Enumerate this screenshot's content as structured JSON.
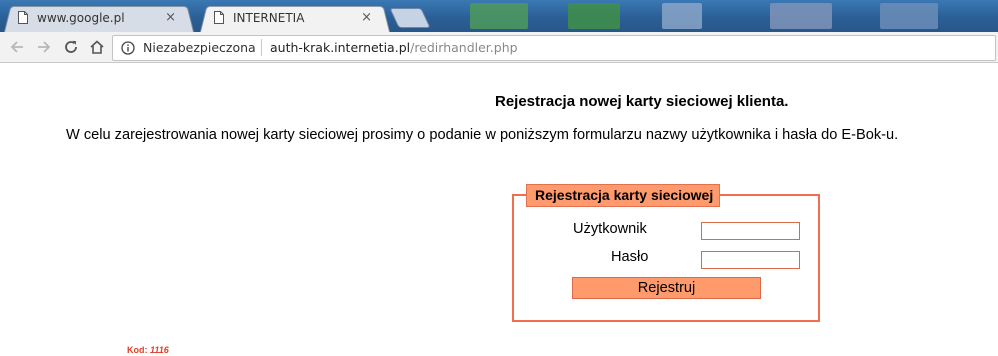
{
  "browser": {
    "tabs": [
      {
        "title": "www.google.pl",
        "close": "×"
      },
      {
        "title": "INTERNETIA",
        "close": "×"
      }
    ],
    "address_bar": {
      "security_label": "Niezabezpieczona",
      "url_host": "auth-krak.internetia.pl",
      "url_path": "/redirhandler.php"
    }
  },
  "page": {
    "title": "Rejestracja nowej karty sieciowej klienta.",
    "intro": "W celu zarejestrowania nowej karty sieciowej prosimy o podanie w poniższym formularzu nazwy użytkownika i hasła do E-Bok-u.",
    "form": {
      "legend": "Rejestracja karty sieciowej",
      "username_label": "Użytkownik",
      "username_value": "",
      "password_label": "Hasło",
      "password_value": "",
      "submit_label": "Rejestruj"
    },
    "code_label": "Kod:",
    "code_value": "1116"
  },
  "colors": {
    "accent_fill": "#ff9a6c",
    "accent_border": "#ef6f4f",
    "code_text": "#e0402a"
  }
}
